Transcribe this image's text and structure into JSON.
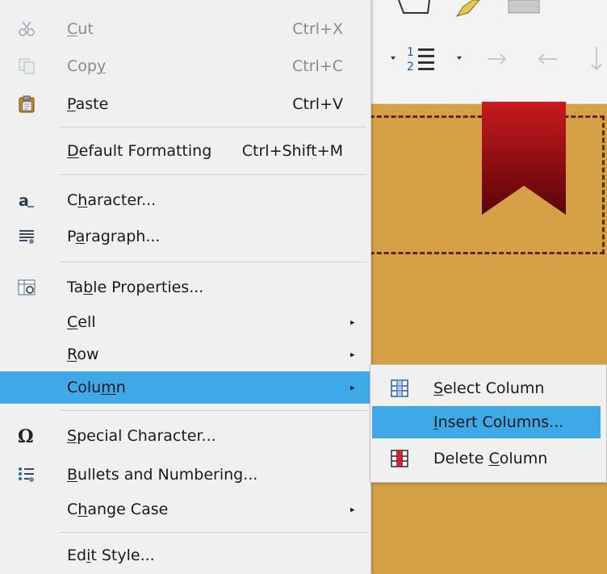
{
  "colors": {
    "menu_bg": "#f0f0f0",
    "highlight": "#3fa8e6",
    "document_bg": "#d6a047",
    "ribbon_red": "#c0141a"
  },
  "context_menu": {
    "items": [
      {
        "label_pre": "",
        "label_u": "C",
        "label_post": "ut",
        "shortcut": "Ctrl+X",
        "disabled": true,
        "icon": "scissors-icon"
      },
      {
        "label_pre": "Cop",
        "label_u": "y",
        "label_post": "",
        "shortcut": "Ctrl+C",
        "disabled": true,
        "icon": "copy-icon"
      },
      {
        "label_pre": "",
        "label_u": "P",
        "label_post": "aste",
        "shortcut": "Ctrl+V",
        "disabled": false,
        "icon": "paste-icon"
      },
      {
        "label_pre": "",
        "label_u": "D",
        "label_post": "efault Formatting",
        "shortcut": "Ctrl+Shift+M"
      },
      {
        "label_pre": "C",
        "label_u": "h",
        "label_post": "aracter...",
        "icon": "character-icon"
      },
      {
        "label_pre": "P",
        "label_u": "a",
        "label_post": "ragraph...",
        "icon": "paragraph-icon"
      },
      {
        "label_pre": "Ta",
        "label_u": "b",
        "label_post": "le Properties...",
        "icon": "table-properties-icon"
      },
      {
        "label_pre": "",
        "label_u": "C",
        "label_post": "ell",
        "submenu": true
      },
      {
        "label_pre": "",
        "label_u": "R",
        "label_post": "ow",
        "submenu": true
      },
      {
        "label_pre": "Colu",
        "label_u": "m",
        "label_post": "n",
        "submenu": true,
        "highlighted": true
      },
      {
        "label_pre": "",
        "label_u": "S",
        "label_post": "pecial Character...",
        "icon": "omega-icon"
      },
      {
        "label_pre": "",
        "label_u": "B",
        "label_post": "ullets and Numbering...",
        "icon": "bullets-icon"
      },
      {
        "label_pre": "C",
        "label_u": "h",
        "label_post": "ange Case",
        "submenu": true
      },
      {
        "label_pre": "Ed",
        "label_u": "i",
        "label_post": "t Style..."
      }
    ]
  },
  "column_submenu": {
    "items": [
      {
        "label_pre": "",
        "label_u": "S",
        "label_post": "elect Column",
        "icon": "select-column-icon"
      },
      {
        "label_pre": "",
        "label_u": "I",
        "label_post": "nsert Columns...",
        "highlighted": true
      },
      {
        "label_pre": "Delete ",
        "label_u": "C",
        "label_post": "olumn",
        "icon": "delete-column-icon"
      }
    ]
  },
  "toolbar": {
    "icons": [
      "shape-icon",
      "highlighter-icon",
      "image-icon",
      "numbering-icon",
      "increase-indent-icon",
      "decrease-indent-icon",
      "paragraph-spacing-icon"
    ]
  }
}
